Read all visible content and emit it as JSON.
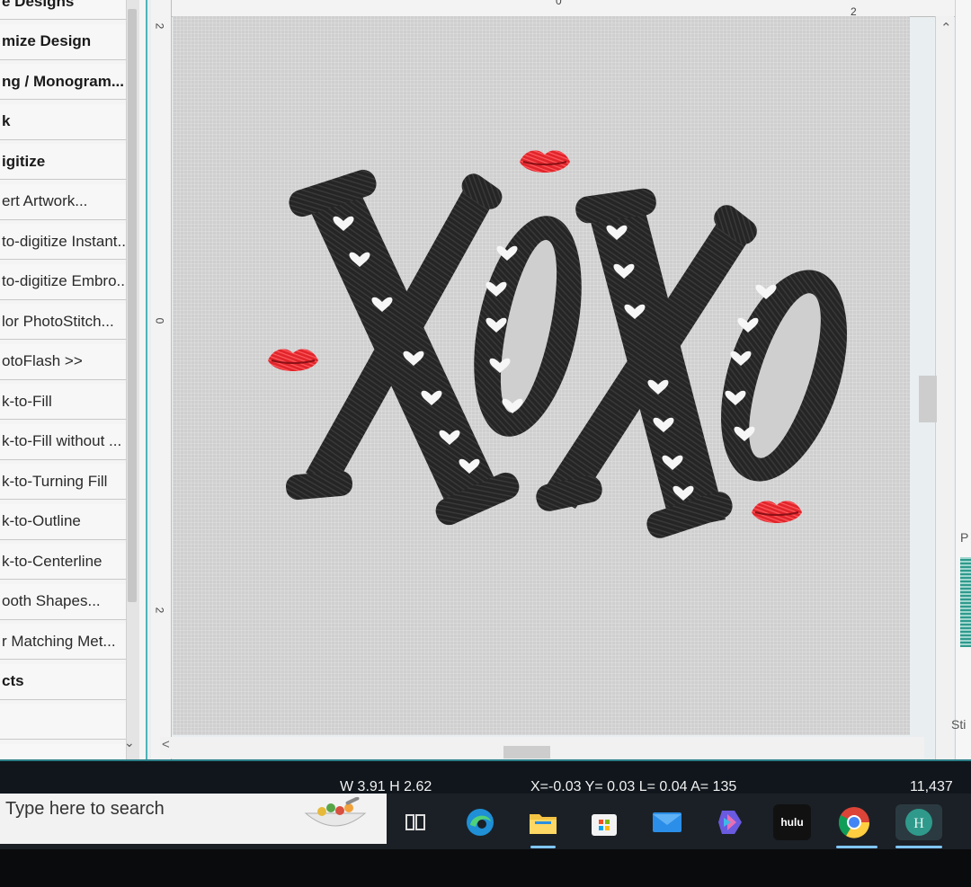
{
  "sidebar": {
    "items": [
      {
        "label": "e Designs",
        "bold": true
      },
      {
        "label": "mize Design",
        "bold": true
      },
      {
        "label": "ng / Monogram...",
        "bold": true
      },
      {
        "label": "k",
        "bold": true
      },
      {
        "label": "igitize",
        "bold": true
      },
      {
        "label": "ert Artwork...",
        "bold": false
      },
      {
        "label": "to-digitize Instant...",
        "bold": false
      },
      {
        "label": "to-digitize Embro...",
        "bold": false
      },
      {
        "label": "lor PhotoStitch...",
        "bold": false
      },
      {
        "label": "otoFlash >>",
        "bold": false
      },
      {
        "label": "k-to-Fill",
        "bold": false
      },
      {
        "label": "k-to-Fill without ...",
        "bold": false
      },
      {
        "label": "k-to-Turning Fill",
        "bold": false
      },
      {
        "label": "k-to-Outline",
        "bold": false
      },
      {
        "label": "k-to-Centerline",
        "bold": false
      },
      {
        "label": "ooth Shapes...",
        "bold": false
      },
      {
        "label": "r Matching Met...",
        "bold": false
      },
      {
        "label": "cts",
        "bold": true
      },
      {
        "label": "",
        "bold": false
      },
      {
        "label": "",
        "bold": false
      }
    ]
  },
  "rulers": {
    "top_labels": [
      "0",
      "2"
    ],
    "left_labels": [
      "2",
      "0",
      "2"
    ]
  },
  "canvas": {
    "design_text": "XOXO",
    "thread_colors": {
      "letters": "#222222",
      "hearts": "#ffffff",
      "lips": "#e0252b"
    }
  },
  "right_panel": {
    "label_top": "P",
    "label_bottom": "Sti"
  },
  "status_bar": {
    "size_readout": "W 3.91 H 2.62",
    "coordinates": "X=-0.03 Y= 0.03 L= 0.04 A= 135",
    "stitch_count": "11,437"
  },
  "taskbar": {
    "search_placeholder": "Type here to search",
    "apps": [
      "Task View",
      "Microsoft Edge",
      "File Explorer",
      "Microsoft Store",
      "Mail",
      "Copilot",
      "hulu",
      "Google Chrome",
      "Hatch Embroidery"
    ],
    "hulu_label": "hulu"
  }
}
